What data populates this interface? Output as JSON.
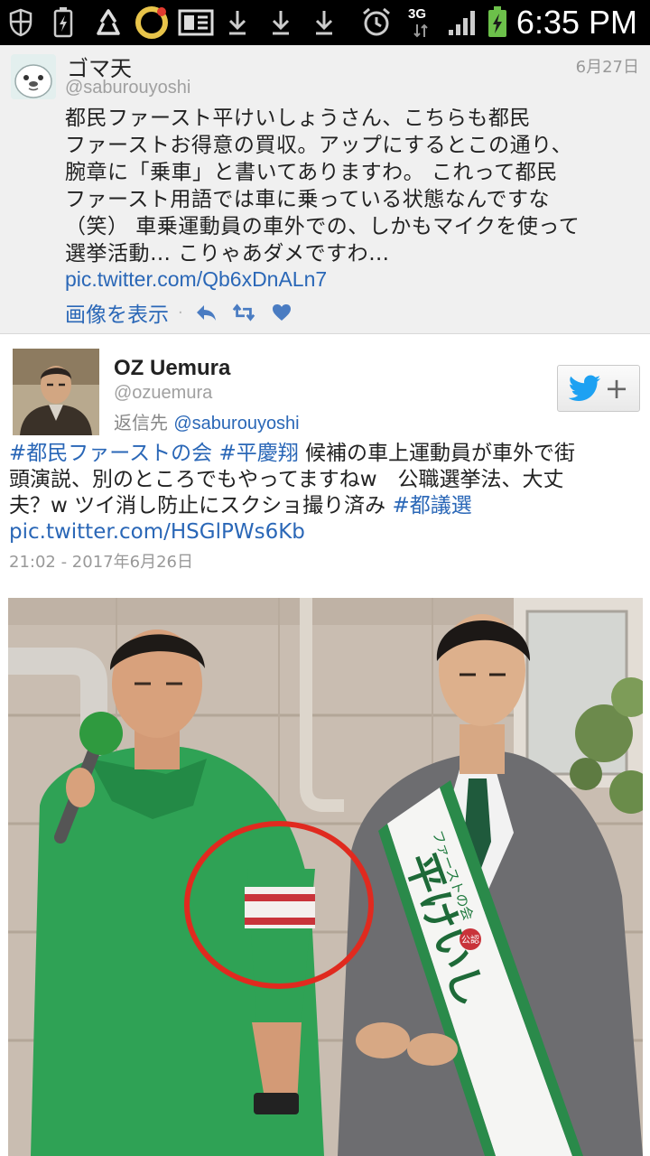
{
  "status_bar": {
    "time": "6:35 PM",
    "network": "3G",
    "icons": [
      "shield-icon",
      "battery-charging-icon",
      "recycle-icon",
      "app-ring-icon",
      "news-icon",
      "download-icon",
      "download-icon",
      "download-icon",
      "alarm-clock-icon",
      "network-arrows-icon",
      "signal-icon",
      "battery-icon"
    ]
  },
  "tweet1": {
    "name": "ゴマ天",
    "handle": "@saburouyoshi",
    "date": "6月27日",
    "body_lines": [
      "都民ファースト平けいしょうさん、こちらも都民",
      "ファーストお得意の買収。アップにするとこの通り、",
      "腕章に「乗車」と書いてありますわ。 これって都民",
      "ファースト用語では車に乗っている状態なんですな",
      "（笑） 車乗運動員の車外での、しかもマイクを使って",
      "選挙活動… こりゃあダメですわ…"
    ],
    "link": "pic.twitter.com/Qb6xDnALn7",
    "show_image": "画像を表示",
    "dot": "·",
    "actions": [
      "reply-icon",
      "retweet-icon",
      "like-icon"
    ]
  },
  "tweet2": {
    "name": "OZ Uemura",
    "handle": "@ozuemura",
    "reply_prefix": "返信先",
    "reply_to": "@saburouyoshi",
    "follow_plus": "+",
    "body": {
      "tag1": "#都民ファーストの会",
      "sp": " ",
      "tag2": "#平慶翔",
      "line1_rest": " 候補の車上運動員が車外で街",
      "line2": "頭演説、別のところでもやってますねw　公職選挙法、大丈",
      "line3": "夫？w ツイ消し防止にスクショ撮り済み ",
      "tag3": "#都議選",
      "link": "pic.twitter.com/HSGlPWs6Kb"
    },
    "timestamp": "21:02 - 2017年6月26日",
    "photo": {
      "sash_text": "平けいし",
      "sash_small": "ファーストの会",
      "sash_badge": "公認"
    }
  },
  "colors": {
    "link_blue": "#2a67b7",
    "twitter_blue": "#1da1f2",
    "tweet1_bg": "#f0f0f0",
    "status_bar_bg": "#000000",
    "circle_red": "#e02a1f"
  }
}
